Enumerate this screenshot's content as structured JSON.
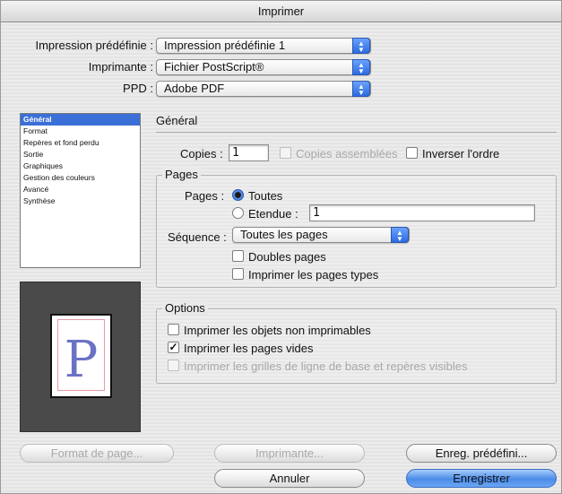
{
  "window": {
    "title": "Imprimer"
  },
  "settings": {
    "preset": {
      "label": "Impression prédéfinie :",
      "value": "Impression prédéfinie 1"
    },
    "printer": {
      "label": "Imprimante :",
      "value": "Fichier PostScript®"
    },
    "ppd": {
      "label": "PPD :",
      "value": "Adobe PDF"
    }
  },
  "sidebar": {
    "items": [
      {
        "label": "Général",
        "selected": true
      },
      {
        "label": "Format"
      },
      {
        "label": "Repères et fond perdu"
      },
      {
        "label": "Sortie"
      },
      {
        "label": "Graphiques"
      },
      {
        "label": "Gestion des couleurs"
      },
      {
        "label": "Avancé"
      },
      {
        "label": "Synthèse"
      }
    ]
  },
  "preview": {
    "letter": "P"
  },
  "general": {
    "title": "Général",
    "copies_label": "Copies :",
    "copies_value": "1",
    "collate_label": "Copies assemblées",
    "reverse_label": "Inverser l'ordre"
  },
  "pages": {
    "legend": "Pages",
    "pages_label": "Pages :",
    "all_label": "Toutes",
    "range_label": "Etendue :",
    "range_value": "1",
    "sequence_label": "Séquence :",
    "sequence_value": "Toutes les pages",
    "spreads_label": "Doubles pages",
    "master_pages_label": "Imprimer les pages types"
  },
  "options": {
    "legend": "Options",
    "nonprinting_label": "Imprimer les objets non imprimables",
    "blank_pages_label": "Imprimer les pages vides",
    "grids_label": "Imprimer les grilles de ligne de base et repères visibles"
  },
  "buttons": {
    "page_setup": "Format de page...",
    "printer": "Imprimante...",
    "save_preset": "Enreg. prédéfini...",
    "cancel": "Annuler",
    "save": "Enregistrer"
  },
  "colors": {
    "accent": "#3a6fd8",
    "preview_letter": "#6b72c4"
  }
}
